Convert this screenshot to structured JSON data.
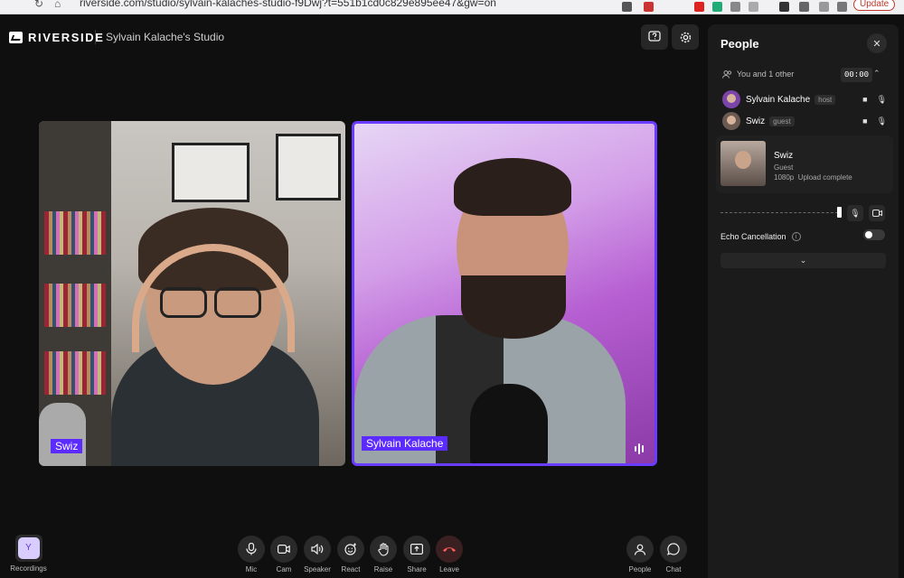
{
  "browser": {
    "url": "riverside.com/studio/sylvain-kalaches-studio-f9Dwj?t=551b1cd0c829e895ee47&gw=on",
    "update_label": "Update"
  },
  "header": {
    "logo_text": "RIVERSIDE",
    "studio_title": "Sylvain Kalache's Studio",
    "help_icon": "help-question-icon",
    "settings_icon": "gear-icon"
  },
  "tiles": [
    {
      "name": "Swiz",
      "active_speaker": false
    },
    {
      "name": "Sylvain Kalache",
      "active_speaker": true
    }
  ],
  "people_panel": {
    "title": "People",
    "you_and_others": "You and 1 other",
    "timer": "00:00",
    "participants": [
      {
        "name": "Sylvain Kalache",
        "role": "host"
      },
      {
        "name": "Swiz",
        "role": "guest"
      }
    ],
    "guest_card": {
      "name": "Swiz",
      "role": "Guest",
      "resolution": "1080p",
      "upload_status": "Upload complete"
    },
    "echo_cancellation_label": "Echo Cancellation",
    "echo_cancellation_on": false
  },
  "toolbar": {
    "recordings_label": "Recordings",
    "recordings_avatar": "Y",
    "mic_label": "Mic",
    "cam_label": "Cam",
    "speaker_label": "Speaker",
    "react_label": "React",
    "raise_label": "Raise",
    "share_label": "Share",
    "leave_label": "Leave",
    "people_label": "People",
    "chat_label": "Chat"
  },
  "colors": {
    "accent": "#5b2bff",
    "active_border": "#6a3cff",
    "leave": "#ff5b5b"
  }
}
